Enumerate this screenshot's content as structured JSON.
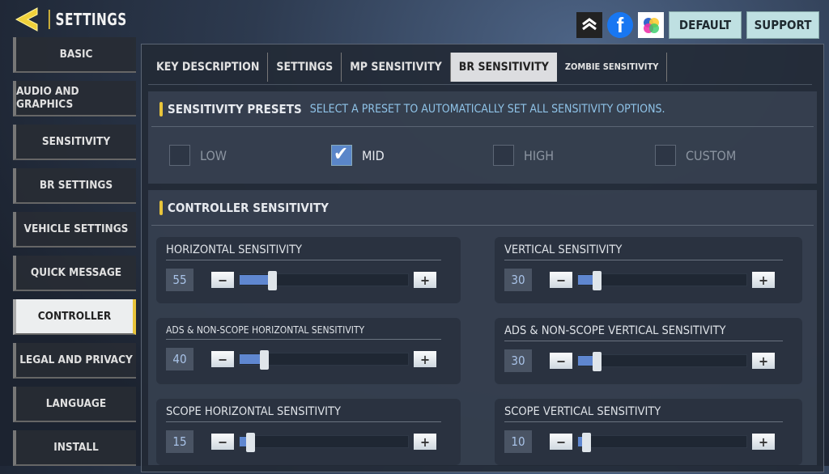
{
  "header": {
    "title": "SETTINGS",
    "default_label": "DEFAULT",
    "support_label": "SUPPORT",
    "icons": [
      "rank-icon",
      "facebook-icon",
      "app-icon"
    ]
  },
  "sidebar": {
    "items": [
      {
        "label": "BASIC"
      },
      {
        "label": "AUDIO AND GRAPHICS"
      },
      {
        "label": "SENSITIVITY"
      },
      {
        "label": "BR SETTINGS"
      },
      {
        "label": "VEHICLE SETTINGS"
      },
      {
        "label": "QUICK MESSAGE"
      },
      {
        "label": "CONTROLLER",
        "active": true
      },
      {
        "label": "LEGAL AND PRIVACY"
      },
      {
        "label": "LANGUAGE"
      },
      {
        "label": "INSTALL"
      }
    ]
  },
  "tabs": [
    {
      "label": "KEY DESCRIPTION"
    },
    {
      "label": "SETTINGS"
    },
    {
      "label": "MP SENSITIVITY"
    },
    {
      "label": "BR SENSITIVITY",
      "active": true
    },
    {
      "label": "ZOMBIE SENSITIVITY"
    }
  ],
  "presets": {
    "title": "SENSITIVITY PRESETS",
    "description": "SELECT A PRESET TO AUTOMATICALLY SET ALL SENSITIVITY OPTIONS.",
    "options": [
      {
        "label": "LOW",
        "checked": false
      },
      {
        "label": "MID",
        "checked": true
      },
      {
        "label": "HIGH",
        "checked": false
      },
      {
        "label": "CUSTOM",
        "checked": false
      }
    ]
  },
  "controller": {
    "title": "CONTROLLER SENSITIVITY",
    "slider_max": 300,
    "sliders": [
      {
        "label": "HORIZONTAL SENSITIVITY",
        "value": 55
      },
      {
        "label": "VERTICAL SENSITIVITY",
        "value": 30
      },
      {
        "label": "ADS & NON-SCOPE HORIZONTAL SENSITIVITY",
        "value": 40
      },
      {
        "label": "ADS & NON-SCOPE VERTICAL SENSITIVITY",
        "value": 30
      },
      {
        "label": "SCOPE HORIZONTAL SENSITIVITY",
        "value": 15
      },
      {
        "label": "SCOPE VERTICAL SENSITIVITY",
        "value": 10
      }
    ]
  },
  "colors": {
    "accent": "#e8c43a",
    "slider_fill": "#5f87d0",
    "button_bg": "#bfe0e2"
  }
}
